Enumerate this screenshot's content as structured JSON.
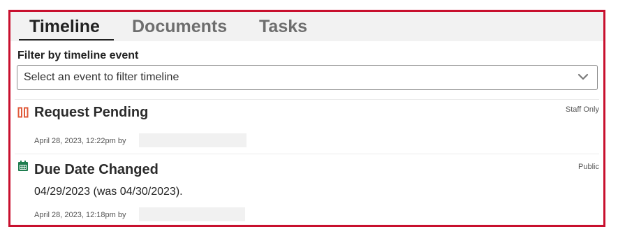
{
  "tabs": [
    {
      "label": "Timeline",
      "active": true
    },
    {
      "label": "Documents",
      "active": false
    },
    {
      "label": "Tasks",
      "active": false
    }
  ],
  "filter": {
    "label": "Filter by timeline event",
    "placeholder": "Select an event to filter timeline"
  },
  "events": [
    {
      "icon": "pause-icon",
      "icon_color": "#e05a3a",
      "title": "Request Pending",
      "visibility": "Staff Only",
      "description": "",
      "meta": "April 28, 2023, 12:22pm by"
    },
    {
      "icon": "calendar-icon",
      "icon_color": "#1e7d4f",
      "title": "Due Date Changed",
      "visibility": "Public",
      "description": "04/29/2023 (was 04/30/2023).",
      "meta": "April 28, 2023, 12:18pm by"
    }
  ],
  "colors": {
    "frame_border": "#c8102e",
    "tabbar_bg": "#f2f2f2"
  }
}
